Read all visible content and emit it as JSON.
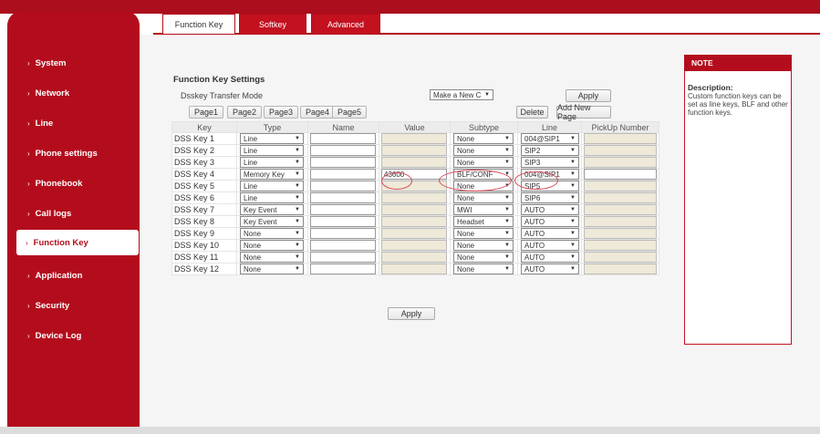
{
  "sidebar": {
    "items": [
      {
        "label": "System"
      },
      {
        "label": "Network"
      },
      {
        "label": "Line"
      },
      {
        "label": "Phone settings"
      },
      {
        "label": "Phonebook"
      },
      {
        "label": "Call logs"
      },
      {
        "label": "Function Key"
      },
      {
        "label": "Application"
      },
      {
        "label": "Security"
      },
      {
        "label": "Device Log"
      }
    ],
    "active": "Function Key"
  },
  "tabs": [
    {
      "label": "Function Key",
      "active": true
    },
    {
      "label": "Softkey",
      "active": false
    },
    {
      "label": "Advanced",
      "active": false
    }
  ],
  "settings": {
    "title": "Function Key Settings",
    "transfer_mode_label": "Dsskey Transfer Mode",
    "transfer_mode_value": "Make a New C",
    "apply_top": "Apply",
    "pages": [
      "Page1",
      "Page2",
      "Page3",
      "Page4",
      "Page5"
    ],
    "delete_label": "Delete",
    "add_page_label": "Add New Page",
    "columns": [
      "Key",
      "Type",
      "Name",
      "Value",
      "Subtype",
      "Line",
      "PickUp Number"
    ],
    "rows": [
      {
        "key": "DSS Key 1",
        "type": "Line",
        "name": "",
        "value": "",
        "subtype": "None",
        "line": "004@SIP1",
        "pickup": ""
      },
      {
        "key": "DSS Key 2",
        "type": "Line",
        "name": "",
        "value": "",
        "subtype": "None",
        "line": "SIP2",
        "pickup": ""
      },
      {
        "key": "DSS Key 3",
        "type": "Line",
        "name": "",
        "value": "",
        "subtype": "None",
        "line": "SIP3",
        "pickup": ""
      },
      {
        "key": "DSS Key 4",
        "type": "Memory Key",
        "name": "",
        "value": "43600",
        "subtype": "BLF/CONF",
        "line": "004@SIP1",
        "pickup": ""
      },
      {
        "key": "DSS Key 5",
        "type": "Line",
        "name": "",
        "value": "",
        "subtype": "None",
        "line": "SIP5",
        "pickup": ""
      },
      {
        "key": "DSS Key 6",
        "type": "Line",
        "name": "",
        "value": "",
        "subtype": "None",
        "line": "SIP6",
        "pickup": ""
      },
      {
        "key": "DSS Key 7",
        "type": "Key Event",
        "name": "",
        "value": "",
        "subtype": "MWI",
        "line": "AUTO",
        "pickup": ""
      },
      {
        "key": "DSS Key 8",
        "type": "Key Event",
        "name": "",
        "value": "",
        "subtype": "Headset",
        "line": "AUTO",
        "pickup": ""
      },
      {
        "key": "DSS Key 9",
        "type": "None",
        "name": "",
        "value": "",
        "subtype": "None",
        "line": "AUTO",
        "pickup": ""
      },
      {
        "key": "DSS Key 10",
        "type": "None",
        "name": "",
        "value": "",
        "subtype": "None",
        "line": "AUTO",
        "pickup": ""
      },
      {
        "key": "DSS Key 11",
        "type": "None",
        "name": "",
        "value": "",
        "subtype": "None",
        "line": "AUTO",
        "pickup": ""
      },
      {
        "key": "DSS Key 12",
        "type": "None",
        "name": "",
        "value": "",
        "subtype": "None",
        "line": "AUTO",
        "pickup": ""
      }
    ],
    "apply_bottom": "Apply"
  },
  "note": {
    "header": "NOTE",
    "desc_title": "Description:",
    "desc_text": "Custom function keys can be set as line keys, BLF and other function keys."
  },
  "colors": {
    "brand": "#b30d1d",
    "disabled_field": "#eee9d8",
    "annotation": "#d84a5a"
  }
}
